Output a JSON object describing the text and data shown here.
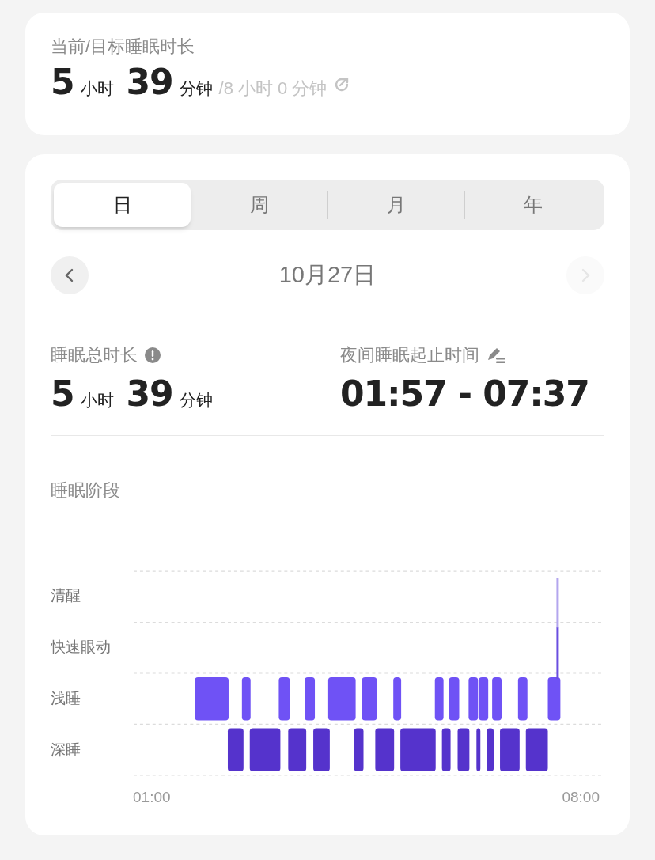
{
  "goal_card": {
    "title": "当前/目标睡眠时长",
    "hours": "5",
    "hours_unit": "小时",
    "minutes": "39",
    "minutes_unit": "分钟",
    "goal": "/8 小时 0 分钟"
  },
  "tabs": [
    {
      "label": "日",
      "selected": true
    },
    {
      "label": "周",
      "selected": false
    },
    {
      "label": "月",
      "selected": false
    },
    {
      "label": "年",
      "selected": false
    }
  ],
  "date_nav": {
    "date": "10月27日",
    "prev_disabled": false,
    "next_disabled": true
  },
  "total_sleep": {
    "label": "睡眠总时长",
    "hours": "5",
    "hours_unit": "小时",
    "minutes": "39",
    "minutes_unit": "分钟"
  },
  "night_sleep": {
    "label": "夜间睡眠起止时间",
    "value": "01:57 - 07:37"
  },
  "stages": {
    "title": "睡眠阶段",
    "labels": [
      "清醒",
      "快速眼动",
      "浅睡",
      "深睡"
    ],
    "x_start": "01:00",
    "x_end": "08:00"
  }
}
